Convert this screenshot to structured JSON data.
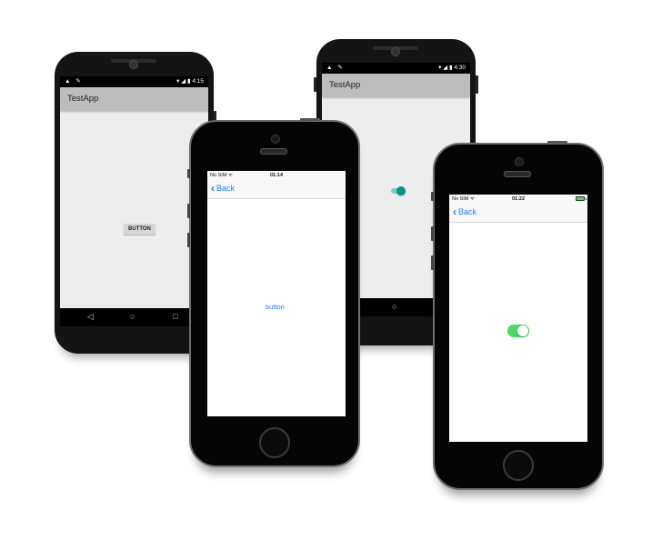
{
  "devices": {
    "android_button": {
      "status_time": "4:15",
      "status_left_icons": "▲ ✎",
      "status_right_icons": "▾ ◢ ▮",
      "title": "TestApp",
      "button_label": "BUTTON",
      "nav": {
        "back": "◁",
        "home": "○",
        "recent": "□"
      }
    },
    "ios_button": {
      "carrier": "No SIM ᯤ",
      "time": "01:14",
      "back_chevron": "‹",
      "back_label": "Back",
      "button_label": "button"
    },
    "android_switch": {
      "status_time": "4:30",
      "status_left_icons": "▲ ✎",
      "status_right_icons": "▾ ◢ ▮",
      "title": "TestApp",
      "switch_on": true,
      "nav": {
        "back": "◁",
        "home": "○",
        "recent": "□"
      }
    },
    "ios_switch": {
      "carrier": "No SIM ᯤ",
      "time": "01:22",
      "back_chevron": "‹",
      "back_label": "Back",
      "switch_on": true,
      "battery_level": 1.0
    }
  },
  "colors": {
    "ios_accent": "#1a82fb",
    "ios_switch_on": "#4cd964",
    "android_accent": "#009688",
    "android_toolbar": "#bdbdbd"
  }
}
